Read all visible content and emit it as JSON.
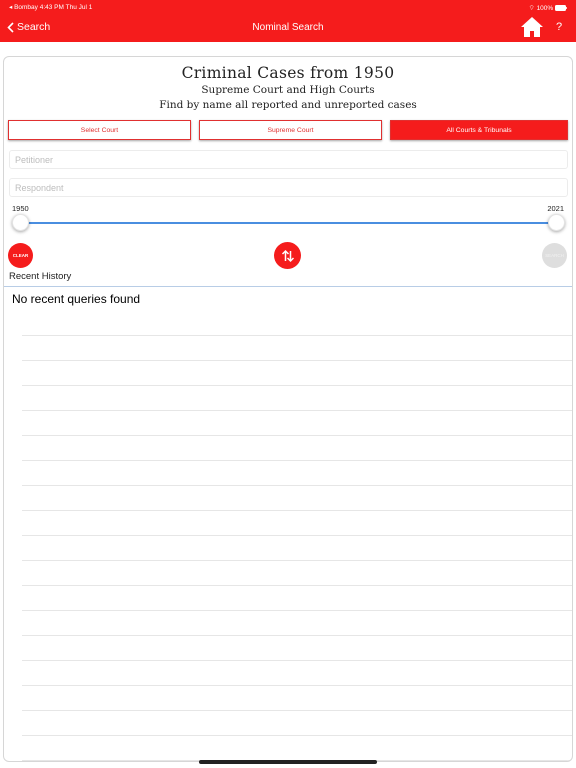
{
  "status_bar": {
    "left": "◂ Bombay   4:43 PM   Thu Jul 1",
    "right": "100%"
  },
  "nav": {
    "back_label": "Search",
    "title": "Nominal Search",
    "help_label": "?",
    "home_icon": "home-icon"
  },
  "header": {
    "title": "Criminal Cases from 1950",
    "subtitle1": "Supreme Court and High Courts",
    "subtitle2": "Find by name all reported and unreported cases"
  },
  "court_buttons": [
    {
      "label": "Select Court",
      "active": false
    },
    {
      "label": "Supreme Court",
      "active": false
    },
    {
      "label": "All Courts & Tribunals",
      "active": true
    }
  ],
  "fields": {
    "petitioner_placeholder": "Petitioner",
    "respondent_placeholder": "Respondent"
  },
  "year_range": {
    "min_label": "1950",
    "max_label": "2021",
    "selected_from": 1950,
    "selected_to": 2021
  },
  "actions": {
    "clear_label": "CLEAR",
    "search_label": "SEARCH",
    "swap_icon": "swap-arrows-icon"
  },
  "history": {
    "label": "Recent History",
    "empty_message": "No recent queries found"
  },
  "colors": {
    "accent": "#f51c1c",
    "slider_track": "#4a8ee0"
  }
}
